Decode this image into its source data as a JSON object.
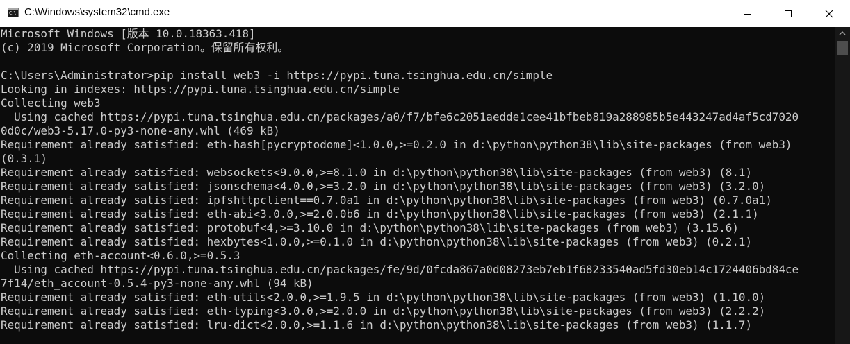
{
  "window": {
    "title": "C:\\Windows\\system32\\cmd.exe",
    "icon": "cmd-icon",
    "icon_text": "C:\\"
  },
  "caption_buttons": {
    "minimize_icon": "minimize-icon",
    "maximize_icon": "maximize-icon",
    "close_icon": "close-icon"
  },
  "colors": {
    "terminal_background": "#0c0c0c",
    "terminal_text": "#cccccc",
    "titlebar_background": "#ffffff"
  },
  "terminal": {
    "lines": [
      "Microsoft Windows [版本 10.0.18363.418]",
      "(c) 2019 Microsoft Corporation。保留所有权利。",
      "",
      "C:\\Users\\Administrator>pip install web3 -i https://pypi.tuna.tsinghua.edu.cn/simple",
      "Looking in indexes: https://pypi.tuna.tsinghua.edu.cn/simple",
      "Collecting web3",
      "  Using cached https://pypi.tuna.tsinghua.edu.cn/packages/a0/f7/bfe6c2051aedde1cee41bfbeb819a288985b5e443247ad4af5cd7020",
      "0d0c/web3-5.17.0-py3-none-any.whl (469 kB)",
      "Requirement already satisfied: eth-hash[pycryptodome]<1.0.0,>=0.2.0 in d:\\python\\python38\\lib\\site-packages (from web3)",
      "(0.3.1)",
      "Requirement already satisfied: websockets<9.0.0,>=8.1.0 in d:\\python\\python38\\lib\\site-packages (from web3) (8.1)",
      "Requirement already satisfied: jsonschema<4.0.0,>=3.2.0 in d:\\python\\python38\\lib\\site-packages (from web3) (3.2.0)",
      "Requirement already satisfied: ipfshttpclient==0.7.0a1 in d:\\python\\python38\\lib\\site-packages (from web3) (0.7.0a1)",
      "Requirement already satisfied: eth-abi<3.0.0,>=2.0.0b6 in d:\\python\\python38\\lib\\site-packages (from web3) (2.1.1)",
      "Requirement already satisfied: protobuf<4,>=3.10.0 in d:\\python\\python38\\lib\\site-packages (from web3) (3.15.6)",
      "Requirement already satisfied: hexbytes<1.0.0,>=0.1.0 in d:\\python\\python38\\lib\\site-packages (from web3) (0.2.1)",
      "Collecting eth-account<0.6.0,>=0.5.3",
      "  Using cached https://pypi.tuna.tsinghua.edu.cn/packages/fe/9d/0fcda867a0d08273eb7eb1f68233540ad5fd30eb14c1724406bd84ce",
      "7f14/eth_account-0.5.4-py3-none-any.whl (94 kB)",
      "Requirement already satisfied: eth-utils<2.0.0,>=1.9.5 in d:\\python\\python38\\lib\\site-packages (from web3) (1.10.0)",
      "Requirement already satisfied: eth-typing<3.0.0,>=2.0.0 in d:\\python\\python38\\lib\\site-packages (from web3) (2.2.2)",
      "Requirement already satisfied: lru-dict<2.0.0,>=1.1.6 in d:\\python\\python38\\lib\\site-packages (from web3) (1.1.7)"
    ]
  },
  "scrollbar": {
    "up_icon": "scroll-up-arrow-icon"
  }
}
